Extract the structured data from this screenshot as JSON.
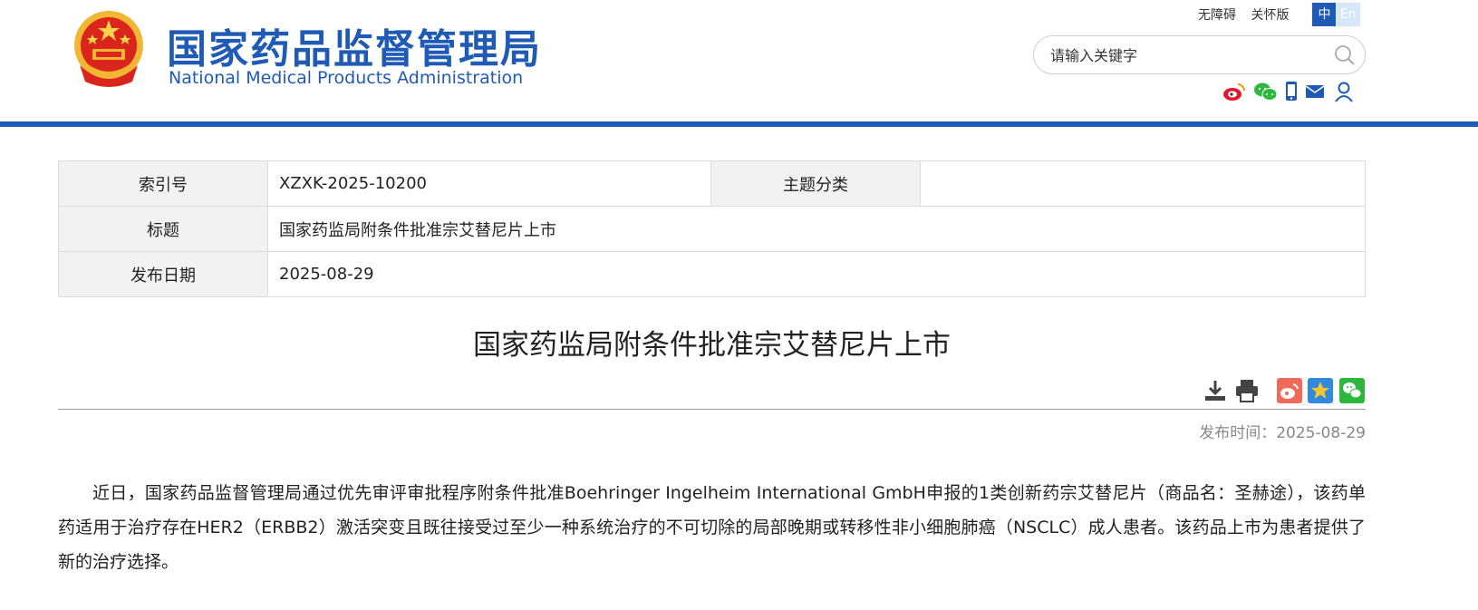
{
  "header": {
    "logo_cn": "国家药品监督管理局",
    "logo_en": "National Medical Products Administration",
    "accessibility_link": "无障碍",
    "elder_link": "关怀版",
    "lang_zh": "中",
    "lang_en": "En",
    "search_placeholder": "请输入关键字",
    "brand_color": "#1f5bb5"
  },
  "social_icons": [
    "weibo-icon",
    "wechat-icon",
    "mobile-icon",
    "mail-icon",
    "user-icon"
  ],
  "info": {
    "index_label": "索引号",
    "index_value": "XZXK-2025-10200",
    "category_label": "主题分类",
    "category_value": "",
    "title_label": "标题",
    "title_value": "国家药监局附条件批准宗艾替尼片上市",
    "date_label": "发布日期",
    "date_value": "2025-08-29"
  },
  "article": {
    "title": "国家药监局附条件批准宗艾替尼片上市",
    "publish_time": "发布时间：2025-08-29",
    "body": "近日，国家药品监督管理局通过优先审评审批程序附条件批准Boehringer Ingelheim International GmbH申报的1类创新药宗艾替尼片（商品名：圣赫途），该药单药适用于治疗存在HER2（ERBB2）激活突变且既往接受过至少一种系统治疗的不可切除的局部晚期或转移性非小细胞肺癌（NSCLC）成人患者。该药品上市为患者提供了新的治疗选择。"
  },
  "tools": [
    "download-icon",
    "print-icon",
    "share-weibo-icon",
    "share-qzone-icon",
    "share-wechat-icon"
  ]
}
